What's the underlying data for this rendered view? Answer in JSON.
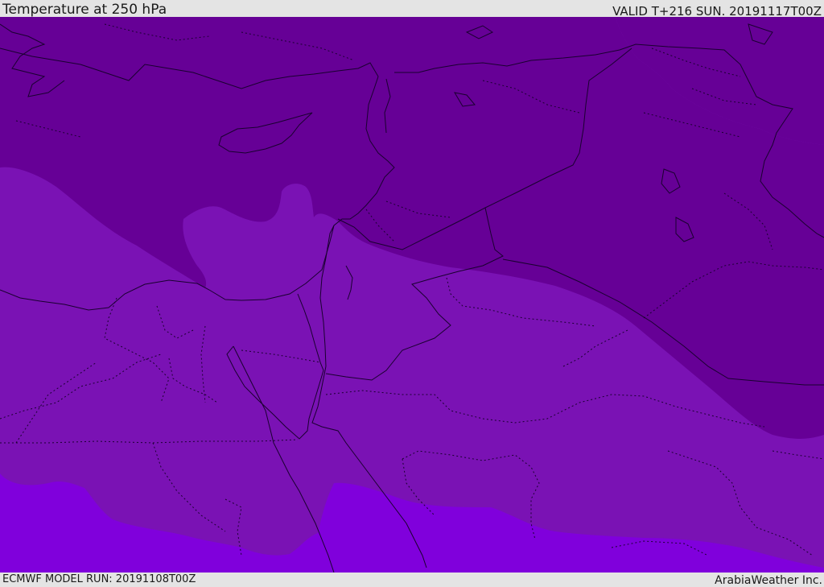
{
  "header": {
    "title": "Temperature at 250 hPa",
    "valid": "VALID T+216 SUN. 20191117T00Z"
  },
  "footer": {
    "model_run": "ECMWF MODEL RUN: 20191108T00Z",
    "credit": "ArabiaWeather Inc."
  },
  "map": {
    "region": "Eastern Mediterranean / Middle East",
    "field": "temperature",
    "level": "250 hPa",
    "shading_colors": {
      "coldest": "#660096",
      "cold": "#7a12b4",
      "warm": "#8000dc"
    },
    "border_color": "#1a0030"
  }
}
